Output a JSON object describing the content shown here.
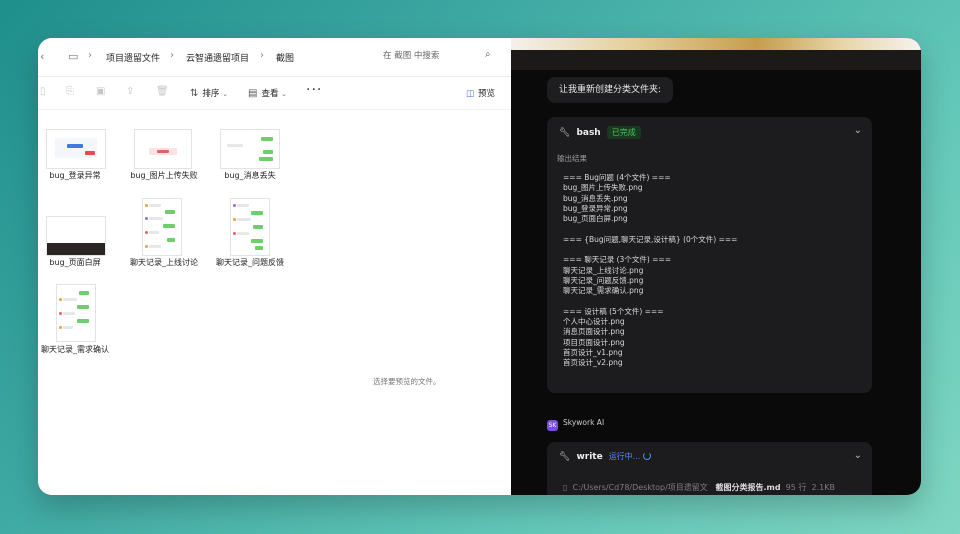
{
  "explorer": {
    "breadcrumbs": [
      "项目遗留文件",
      "云智通遗留项目",
      "截图"
    ],
    "search_placeholder": "在 截图 中搜索",
    "toolbar": {
      "sort_label": "排序",
      "view_label": "查看",
      "more_label": "···",
      "preview_label": "预览"
    },
    "files": [
      {
        "name": "bug_登录异常"
      },
      {
        "name": "bug_图片上传失败"
      },
      {
        "name": "bug_消息丢失"
      },
      {
        "name": "bug_页面白屏"
      },
      {
        "name": "聊天记录_上线讨论"
      },
      {
        "name": "聊天记录_问题反馈"
      },
      {
        "name": "聊天记录_需求确认"
      }
    ],
    "empty_message": "选择要预览的文件。"
  },
  "chat": {
    "user_message": "让我重新创建分类文件夹:",
    "bash_panel": {
      "tool_name": "bash",
      "status": "已完成",
      "output_label": "输出结果",
      "output_lines": [
        "=== Bug问题 (4个文件) ===",
        "bug_图片上传失败.png",
        "bug_消息丢失.png",
        "bug_登录异常.png",
        "bug_页面白屏.png",
        "",
        "=== {Bug问题,聊天记录,设计稿} (0个文件) ===",
        "",
        "=== 聊天记录 (3个文件) ===",
        "聊天记录_上线讨论.png",
        "聊天记录_问题反馈.png",
        "聊天记录_需求确认.png",
        "",
        "=== 设计稿 (5个文件) ===",
        "个人中心设计.png",
        "消息页面设计.png",
        "项目页面设计.png",
        "首页设计_v1.png",
        "首页设计_v2.png"
      ]
    },
    "assistant_name": "Skywork AI",
    "assistant_logo": "SK",
    "write_panel": {
      "tool_name": "write",
      "status": "运行中...",
      "path": "C:/Users/Cd78/Desktop/项目遗留文",
      "file_name": "截图分类报告.md",
      "lines": "95 行",
      "size": "2.1KB"
    }
  },
  "colors": {
    "success": "#48c45e",
    "running": "#4a8df0",
    "chat_bg": "#0a0a0b",
    "panel_bg": "#1c1c1f"
  }
}
